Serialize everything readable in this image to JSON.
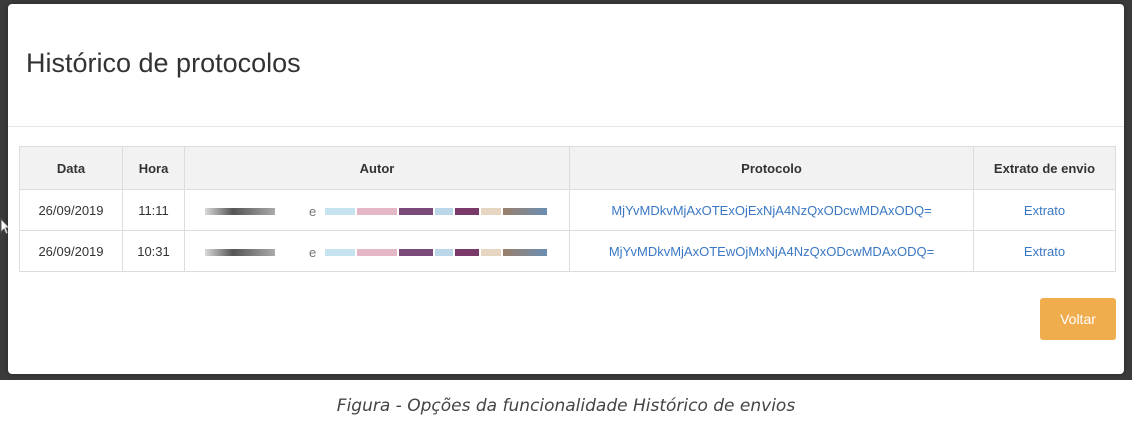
{
  "modal": {
    "title": "Histórico de protocolos",
    "close_label": "Voltar"
  },
  "table": {
    "headers": {
      "data": "Data",
      "hora": "Hora",
      "autor": "Autor",
      "protocolo": "Protocolo",
      "extrato": "Extrato de envio"
    },
    "rows": [
      {
        "data": "26/09/2019",
        "hora": "11:11",
        "autor_visible": "e",
        "protocolo": "MjYvMDkvMjAxOTExOjExNjA4NzQxODcwMDAxODQ=",
        "extrato": "Extrato"
      },
      {
        "data": "26/09/2019",
        "hora": "10:31",
        "autor_visible": "e",
        "protocolo": "MjYvMDkvMjAxOTEwOjMxNjA4NzQxODcwMDAxODQ=",
        "extrato": "Extrato"
      }
    ]
  },
  "caption": "Figura - Opções da funcionalidade Histórico de envios",
  "colors": {
    "link": "#3a78c4",
    "primary_button": "#f0ad4e",
    "header_bg": "#f2f2f2"
  }
}
